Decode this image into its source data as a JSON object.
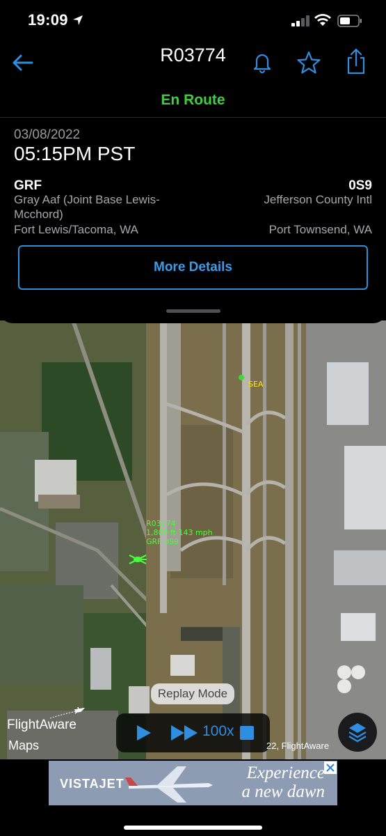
{
  "status_bar": {
    "time": "19:09"
  },
  "header": {
    "title": "R03774",
    "flight_status": "En Route"
  },
  "departure": {
    "date": "03/08/2022",
    "time": "05:15PM PST"
  },
  "origin": {
    "code": "GRF",
    "name": "Gray Aaf (Joint Base Lewis-Mcchord)",
    "city": "Fort Lewis/Tacoma, WA"
  },
  "destination": {
    "code": "0S9",
    "name": "Jefferson County Intl",
    "city": "Port Townsend, WA"
  },
  "buttons": {
    "more_details": "More Details"
  },
  "map": {
    "aircraft_label": {
      "ident": "R03774",
      "alt_speed": "1,800 ft 143 mph",
      "route": "GRF 0S9"
    },
    "airport_label": "SEA",
    "replay_mode": "Replay Mode",
    "speed": "100x",
    "brand": "FlightAware",
    "maps_credit": "Maps",
    "copyright": "22, FlightAware",
    "colors": {
      "label": "#46ff3a",
      "airport": "#ffe600",
      "accent": "#2f8ee0"
    }
  },
  "ad": {
    "brand": "VISTAJET",
    "tagline_1": "Experience",
    "tagline_2": "a new dawn"
  },
  "icons": [
    "location-arrow-icon",
    "signal-icon",
    "wifi-icon",
    "battery-icon",
    "back-arrow-icon",
    "bell-icon",
    "star-icon",
    "share-icon",
    "helicopter-icon",
    "play-icon",
    "fast-forward-icon",
    "stop-icon",
    "layers-icon",
    "apple-icon"
  ]
}
